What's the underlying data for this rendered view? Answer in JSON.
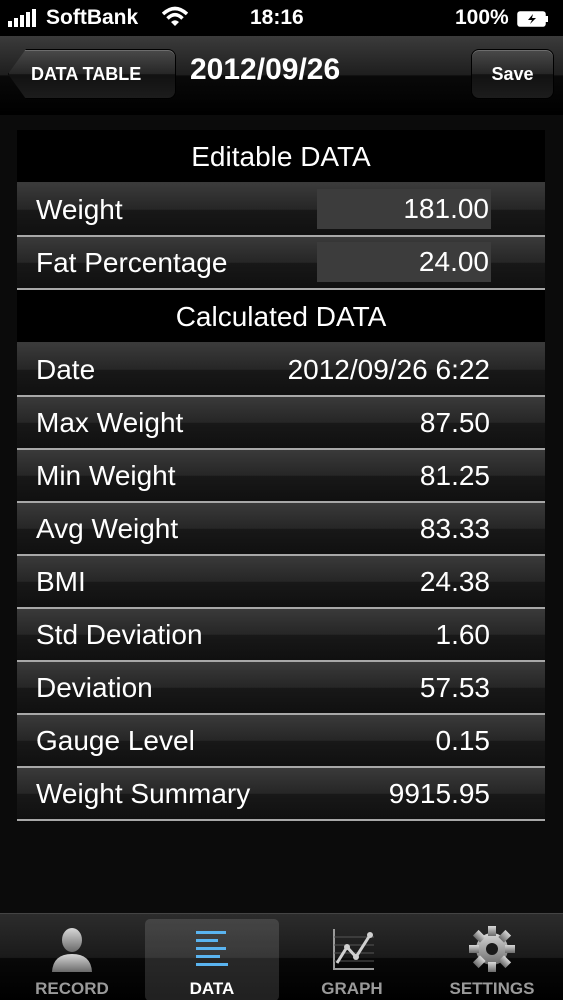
{
  "status_bar": {
    "carrier": "SoftBank",
    "time": "18:16",
    "battery": "100%",
    "icons": [
      "signal-icon",
      "wifi-icon",
      "battery-icon"
    ]
  },
  "nav": {
    "back_label": "DATA TABLE",
    "title": "2012/09/26",
    "save_label": "Save"
  },
  "editable": {
    "header": "Editable DATA",
    "rows": [
      {
        "label": "Weight",
        "value": "181.00"
      },
      {
        "label": "Fat Percentage",
        "value": "24.00"
      }
    ]
  },
  "calculated": {
    "header": "Calculated DATA",
    "rows": [
      {
        "label": "Date",
        "value": "2012/09/26 6:22"
      },
      {
        "label": "Max Weight",
        "value": "87.50"
      },
      {
        "label": "Min Weight",
        "value": "81.25"
      },
      {
        "label": "Avg Weight",
        "value": "83.33"
      },
      {
        "label": "BMI",
        "value": "24.38"
      },
      {
        "label": "Std Deviation",
        "value": "1.60"
      },
      {
        "label": "Deviation",
        "value": "57.53"
      },
      {
        "label": "Gauge Level",
        "value": "0.15"
      },
      {
        "label": "Weight Summary",
        "value": "9915.95"
      }
    ]
  },
  "tabs": [
    {
      "label": "RECORD",
      "icon": "person-icon",
      "selected": false
    },
    {
      "label": "DATA",
      "icon": "list-icon",
      "selected": true
    },
    {
      "label": "GRAPH",
      "icon": "graph-icon",
      "selected": false
    },
    {
      "label": "SETTINGS",
      "icon": "gear-icon",
      "selected": false
    }
  ],
  "colors": {
    "background": "#0a0a0a",
    "row_separator": "#a8a8a8",
    "input_fill": "#3c3c3c",
    "selected_tab_icon": "#5ab4f0"
  }
}
